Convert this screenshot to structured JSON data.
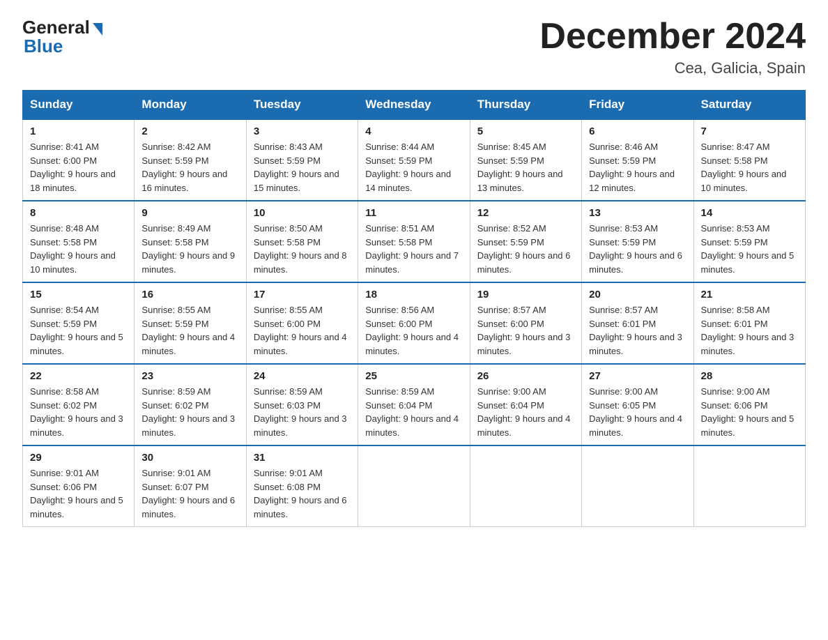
{
  "header": {
    "logo_general": "General",
    "logo_blue": "Blue",
    "title": "December 2024",
    "location": "Cea, Galicia, Spain"
  },
  "days_of_week": [
    "Sunday",
    "Monday",
    "Tuesday",
    "Wednesday",
    "Thursday",
    "Friday",
    "Saturday"
  ],
  "weeks": [
    [
      {
        "day": "1",
        "sunrise": "8:41 AM",
        "sunset": "6:00 PM",
        "daylight": "9 hours and 18 minutes."
      },
      {
        "day": "2",
        "sunrise": "8:42 AM",
        "sunset": "5:59 PM",
        "daylight": "9 hours and 16 minutes."
      },
      {
        "day": "3",
        "sunrise": "8:43 AM",
        "sunset": "5:59 PM",
        "daylight": "9 hours and 15 minutes."
      },
      {
        "day": "4",
        "sunrise": "8:44 AM",
        "sunset": "5:59 PM",
        "daylight": "9 hours and 14 minutes."
      },
      {
        "day": "5",
        "sunrise": "8:45 AM",
        "sunset": "5:59 PM",
        "daylight": "9 hours and 13 minutes."
      },
      {
        "day": "6",
        "sunrise": "8:46 AM",
        "sunset": "5:59 PM",
        "daylight": "9 hours and 12 minutes."
      },
      {
        "day": "7",
        "sunrise": "8:47 AM",
        "sunset": "5:58 PM",
        "daylight": "9 hours and 10 minutes."
      }
    ],
    [
      {
        "day": "8",
        "sunrise": "8:48 AM",
        "sunset": "5:58 PM",
        "daylight": "9 hours and 10 minutes."
      },
      {
        "day": "9",
        "sunrise": "8:49 AM",
        "sunset": "5:58 PM",
        "daylight": "9 hours and 9 minutes."
      },
      {
        "day": "10",
        "sunrise": "8:50 AM",
        "sunset": "5:58 PM",
        "daylight": "9 hours and 8 minutes."
      },
      {
        "day": "11",
        "sunrise": "8:51 AM",
        "sunset": "5:58 PM",
        "daylight": "9 hours and 7 minutes."
      },
      {
        "day": "12",
        "sunrise": "8:52 AM",
        "sunset": "5:59 PM",
        "daylight": "9 hours and 6 minutes."
      },
      {
        "day": "13",
        "sunrise": "8:53 AM",
        "sunset": "5:59 PM",
        "daylight": "9 hours and 6 minutes."
      },
      {
        "day": "14",
        "sunrise": "8:53 AM",
        "sunset": "5:59 PM",
        "daylight": "9 hours and 5 minutes."
      }
    ],
    [
      {
        "day": "15",
        "sunrise": "8:54 AM",
        "sunset": "5:59 PM",
        "daylight": "9 hours and 5 minutes."
      },
      {
        "day": "16",
        "sunrise": "8:55 AM",
        "sunset": "5:59 PM",
        "daylight": "9 hours and 4 minutes."
      },
      {
        "day": "17",
        "sunrise": "8:55 AM",
        "sunset": "6:00 PM",
        "daylight": "9 hours and 4 minutes."
      },
      {
        "day": "18",
        "sunrise": "8:56 AM",
        "sunset": "6:00 PM",
        "daylight": "9 hours and 4 minutes."
      },
      {
        "day": "19",
        "sunrise": "8:57 AM",
        "sunset": "6:00 PM",
        "daylight": "9 hours and 3 minutes."
      },
      {
        "day": "20",
        "sunrise": "8:57 AM",
        "sunset": "6:01 PM",
        "daylight": "9 hours and 3 minutes."
      },
      {
        "day": "21",
        "sunrise": "8:58 AM",
        "sunset": "6:01 PM",
        "daylight": "9 hours and 3 minutes."
      }
    ],
    [
      {
        "day": "22",
        "sunrise": "8:58 AM",
        "sunset": "6:02 PM",
        "daylight": "9 hours and 3 minutes."
      },
      {
        "day": "23",
        "sunrise": "8:59 AM",
        "sunset": "6:02 PM",
        "daylight": "9 hours and 3 minutes."
      },
      {
        "day": "24",
        "sunrise": "8:59 AM",
        "sunset": "6:03 PM",
        "daylight": "9 hours and 3 minutes."
      },
      {
        "day": "25",
        "sunrise": "8:59 AM",
        "sunset": "6:04 PM",
        "daylight": "9 hours and 4 minutes."
      },
      {
        "day": "26",
        "sunrise": "9:00 AM",
        "sunset": "6:04 PM",
        "daylight": "9 hours and 4 minutes."
      },
      {
        "day": "27",
        "sunrise": "9:00 AM",
        "sunset": "6:05 PM",
        "daylight": "9 hours and 4 minutes."
      },
      {
        "day": "28",
        "sunrise": "9:00 AM",
        "sunset": "6:06 PM",
        "daylight": "9 hours and 5 minutes."
      }
    ],
    [
      {
        "day": "29",
        "sunrise": "9:01 AM",
        "sunset": "6:06 PM",
        "daylight": "9 hours and 5 minutes."
      },
      {
        "day": "30",
        "sunrise": "9:01 AM",
        "sunset": "6:07 PM",
        "daylight": "9 hours and 6 minutes."
      },
      {
        "day": "31",
        "sunrise": "9:01 AM",
        "sunset": "6:08 PM",
        "daylight": "9 hours and 6 minutes."
      },
      null,
      null,
      null,
      null
    ]
  ]
}
